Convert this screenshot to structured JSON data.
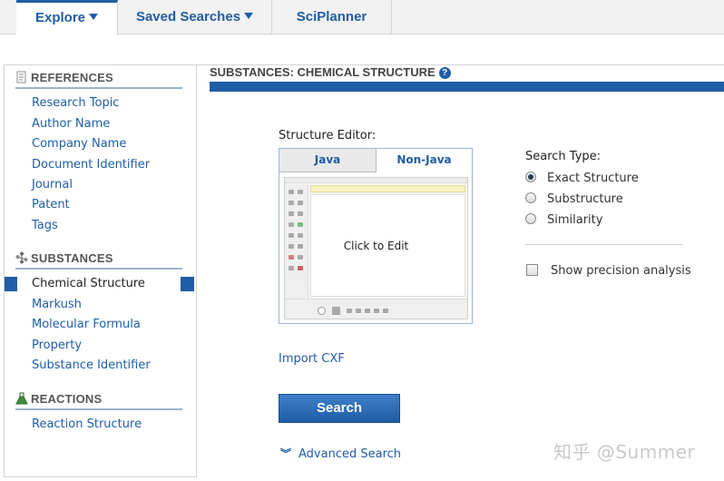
{
  "top_tabs": [
    {
      "label": "Explore",
      "has_dropdown": true,
      "active": true
    },
    {
      "label": "Saved Searches",
      "has_dropdown": true,
      "active": false
    },
    {
      "label": "SciPlanner",
      "has_dropdown": false,
      "active": false
    }
  ],
  "sidebar": {
    "references": {
      "heading": "REFERENCES",
      "icon": "document-icon",
      "items": [
        "Research Topic",
        "Author Name",
        "Company Name",
        "Document Identifier",
        "Journal",
        "Patent",
        "Tags"
      ]
    },
    "substances": {
      "heading": "SUBSTANCES",
      "icon": "molecule-icon",
      "items": [
        "Chemical Structure",
        "Markush",
        "Molecular Formula",
        "Property",
        "Substance Identifier"
      ],
      "active_item": "Chemical Structure"
    },
    "reactions": {
      "heading": "REACTIONS",
      "icon": "flask-icon",
      "items": [
        "Reaction Structure"
      ]
    }
  },
  "main": {
    "title": "SUBSTANCES: CHEMICAL STRUCTURE",
    "help_glyph": "?",
    "editor": {
      "label": "Structure Editor:",
      "tabs": [
        "Java",
        "Non-Java"
      ],
      "active_tab": "Non-Java",
      "placeholder": "Click to Edit"
    },
    "search_type": {
      "label": "Search Type:",
      "options": [
        "Exact Structure",
        "Substructure",
        "Similarity"
      ],
      "selected": "Exact Structure"
    },
    "precision_checkbox": {
      "label": "Show precision analysis",
      "checked": false
    },
    "import_link": "Import CXF",
    "search_button": "Search",
    "advanced_link": "Advanced Search",
    "advanced_glyph": "︾"
  },
  "watermark": "知乎 @Summer",
  "colors": {
    "accent": "#1f5da6",
    "tab_bar": "#f2f2f2"
  }
}
